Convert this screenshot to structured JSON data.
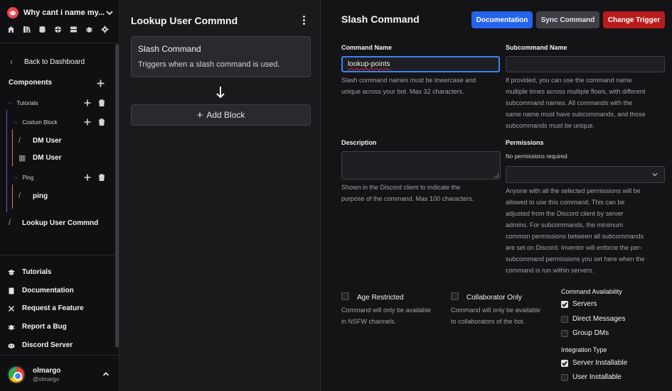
{
  "sidebar": {
    "server_name": "Why cant i name my...",
    "icons": [
      "home-icon",
      "book-icon",
      "database-icon",
      "globe-icon",
      "server-icon",
      "bug-icon",
      "gear-icon"
    ],
    "back_label": "Back to Dashboard",
    "components_label": "Components",
    "tree": {
      "tutorials": "Tutorials",
      "costum_block": "Costum Block",
      "dm_user_1": "DM User",
      "dm_user_2": "DM User",
      "ping_folder": "Ping",
      "ping_cmd": "ping",
      "lookup": "Lookup User Commnd"
    },
    "bottom": {
      "tutorials": "Tutorials",
      "documentation": "Documentation",
      "request": "Request a Feature",
      "bug": "Report a Bug",
      "discord": "Discord Server"
    },
    "user": {
      "name": "olmargo",
      "handle": "@olmargo"
    }
  },
  "middle": {
    "title": "Lookup User Commnd",
    "trigger_title": "Slash Command",
    "trigger_desc": "Triggers when a slash command is used.",
    "add_block": "Add Block"
  },
  "main": {
    "title": "Slash Command",
    "buttons": {
      "documentation": "Documentation",
      "sync": "Sync Command",
      "change": "Change Trigger"
    },
    "command_name": {
      "label": "Command Name",
      "value": "lookup-points",
      "help_1": "Slash command names must be lowercase and",
      "help_2": "unique across your bot. Max 32 characters."
    },
    "subcommand_name": {
      "label": "Subcommand Name",
      "value": "",
      "help_1": "If provided, you can use the command name",
      "help_2": "multiple times across multiple flows, with different",
      "help_3": "subcommand names. All commands with the",
      "help_4": "same name must have subcommands, and those",
      "help_5": "subcommands must be unique."
    },
    "description": {
      "label": "Description",
      "value": "",
      "help_1": "Shown in the Discord client to indicate the",
      "help_2": "purpose of the command. Max 100 characters."
    },
    "permissions": {
      "label": "Permissions",
      "sub": "No permissions required",
      "help_1": "Anyone with all the selected permissions will be",
      "help_2": "allowed to use this command. This can be",
      "help_3": "adjusted from the Discord client by server",
      "help_4": "admins. For subcommands, the minimum",
      "help_5": "common permissions between all subcommands",
      "help_6": "are set on Discord. Inventor will enforce the per-",
      "help_7": "subcommand permissions you set here when the",
      "help_8": "command is run within servers."
    },
    "age_restricted": {
      "label": "Age Restricted",
      "checked": false,
      "help_1": "Command will only be available",
      "help_2": "in NSFW channels."
    },
    "collaborator_only": {
      "label": "Collaborator Only",
      "checked": false,
      "help_1": "Command will only be available",
      "help_2": "to collaborators of the bot."
    },
    "availability": {
      "label": "Command Availability",
      "servers": "Servers",
      "servers_checked": true,
      "dms": "Direct Messages",
      "dms_checked": false,
      "group_dms": "Group DMs",
      "group_dms_checked": false
    },
    "integration": {
      "label": "Integration Type",
      "server_installable": "Server Installable",
      "server_checked": true,
      "user_installable": "User Installable",
      "user_checked": false
    }
  },
  "colors": {
    "accent_blue": "#2563eb",
    "danger_red": "#b91c1c",
    "tree_purple": "#6d5bd0",
    "tree_orange": "#d9822b",
    "discord_red": "#e8474f"
  }
}
